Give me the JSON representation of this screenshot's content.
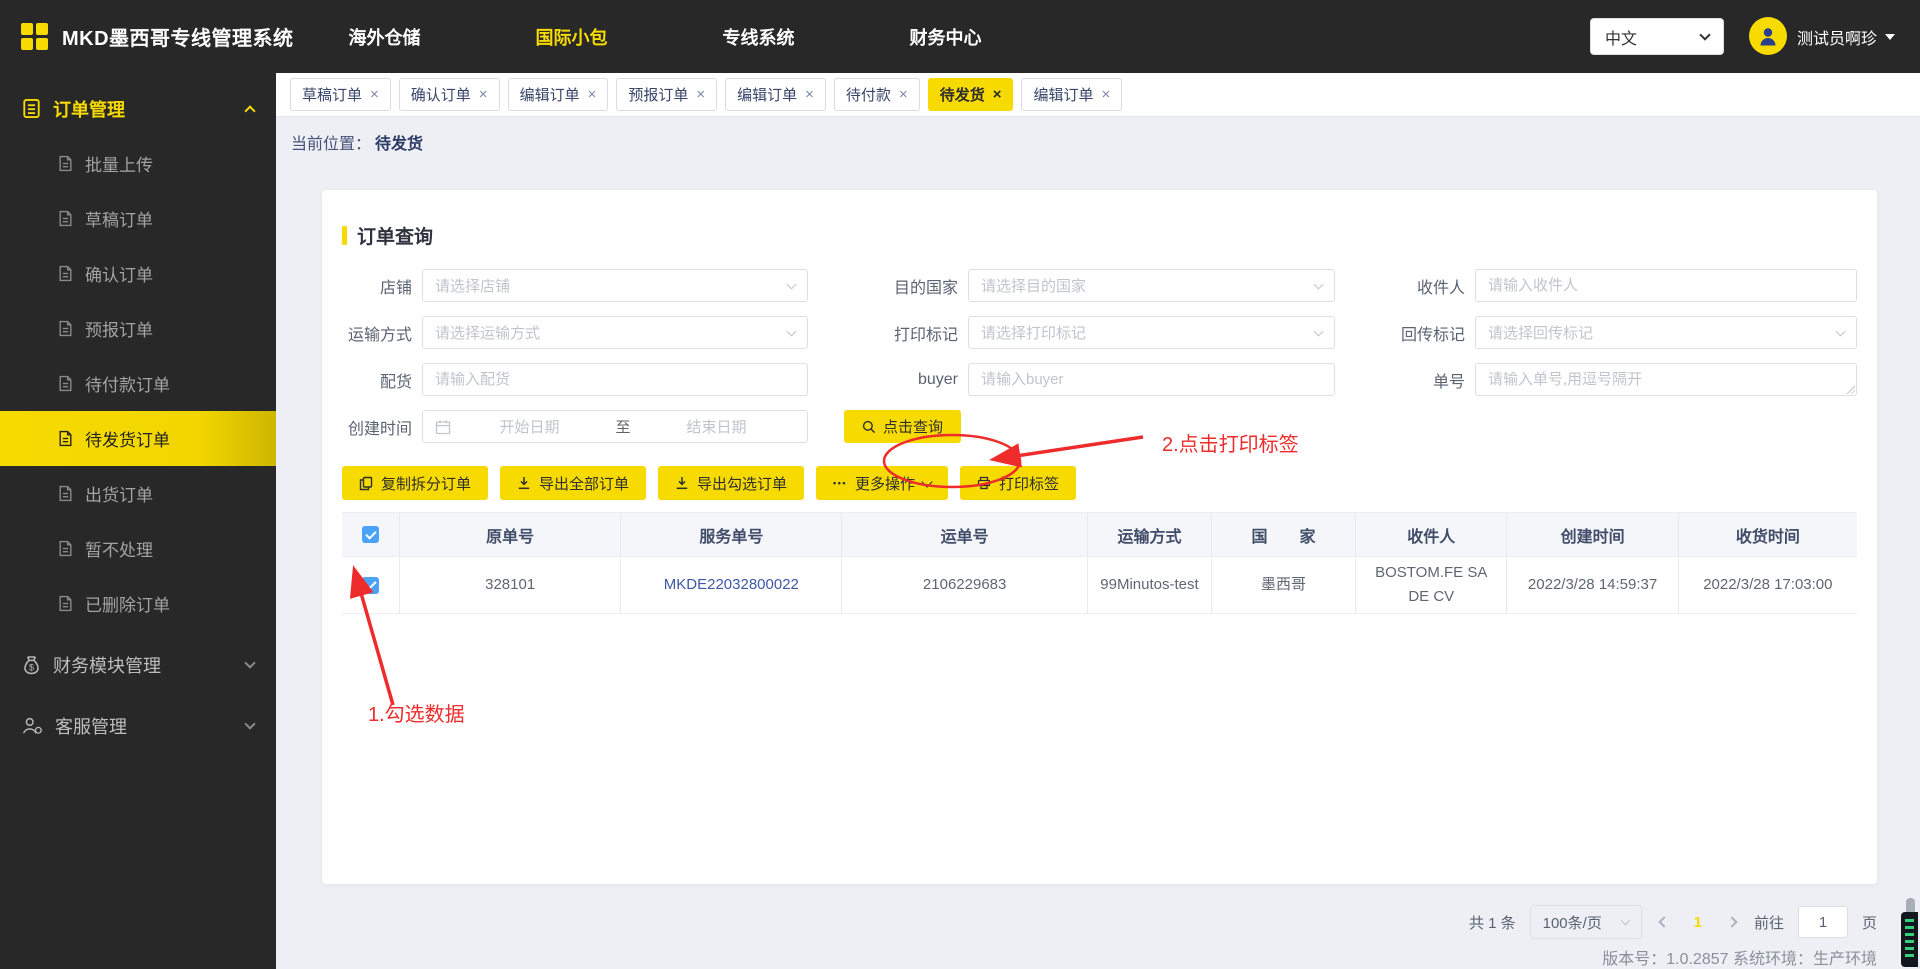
{
  "header": {
    "title": "MKD墨西哥专线管理系统",
    "nav": [
      {
        "label": "海外仓储",
        "active": false
      },
      {
        "label": "国际小包",
        "active": true
      },
      {
        "label": "专线系统",
        "active": false
      },
      {
        "label": "财务中心",
        "active": false
      }
    ],
    "language": "中文",
    "username": "测试员啊珍"
  },
  "sidebar": {
    "groups": [
      {
        "label": "订单管理",
        "expanded": true
      },
      {
        "label": "财务模块管理",
        "expanded": false
      },
      {
        "label": "客服管理",
        "expanded": false
      }
    ],
    "order_items": [
      "批量上传",
      "草稿订单",
      "确认订单",
      "预报订单",
      "待付款订单",
      "待发货订单",
      "出货订单",
      "暂不处理",
      "已删除订单"
    ],
    "active_item": "待发货订单"
  },
  "tabs": [
    {
      "label": "草稿订单",
      "active": false
    },
    {
      "label": "确认订单",
      "active": false
    },
    {
      "label": "编辑订单",
      "active": false
    },
    {
      "label": "预报订单",
      "active": false
    },
    {
      "label": "编辑订单",
      "active": false
    },
    {
      "label": "待付款",
      "active": false
    },
    {
      "label": "待发货",
      "active": true
    },
    {
      "label": "编辑订单",
      "active": false
    }
  ],
  "icons": {
    "close": "×",
    "more_dots": "•••"
  },
  "breadcrumb": {
    "prefix": "当前位置：",
    "current": "待发货"
  },
  "search": {
    "title": "订单查询",
    "shop": {
      "label": "店铺",
      "placeholder": "请选择店铺"
    },
    "country": {
      "label": "目的国家",
      "placeholder": "请选择目的国家"
    },
    "receiver": {
      "label": "收件人",
      "placeholder": "请输入收件人"
    },
    "transport": {
      "label": "运输方式",
      "placeholder": "请选择运输方式"
    },
    "print_mark": {
      "label": "打印标记",
      "placeholder": "请选择打印标记"
    },
    "return_mark": {
      "label": "回传标记",
      "placeholder": "请选择回传标记"
    },
    "allocation": {
      "label": "配货",
      "placeholder": "请输入配货"
    },
    "buyer": {
      "label": "buyer",
      "placeholder": "请输入buyer"
    },
    "order_no": {
      "label": "单号",
      "placeholder": "请输入单号,用逗号隔开"
    },
    "created": {
      "label": "创建时间",
      "start_placeholder": "开始日期",
      "to": "至",
      "end_placeholder": "结束日期"
    },
    "query_button": "点击查询"
  },
  "toolbar": {
    "buttons": [
      {
        "label": "复制拆分订单"
      },
      {
        "label": "导出全部订单"
      },
      {
        "label": "导出勾选订单"
      },
      {
        "label": "更多操作"
      },
      {
        "label": "打印标签"
      }
    ]
  },
  "table": {
    "headers": [
      "原单号",
      "服务单号",
      "运单号",
      "运输方式",
      "国　　家",
      "收件人",
      "创建时间",
      "收货时间"
    ],
    "rows": [
      {
        "checked": true,
        "origin_no": "328101",
        "service_no": "MKDE22032800022",
        "waybill_no": "2106229683",
        "transport": "99Minutos-test",
        "country": "墨西哥",
        "receiver": "BOSTOM.FE SA DE CV",
        "created_at": "2022/3/28 14:59:37",
        "received_at": "2022/3/28 17:03:00"
      }
    ]
  },
  "annotations": {
    "step1": "1.勾选数据",
    "step2": "2.点击打印标签"
  },
  "pagination": {
    "total": "共 1 条",
    "page_size": "100条/页",
    "current_page": "1",
    "goto_label": "前往",
    "goto_value": "1",
    "page_unit": "页"
  },
  "footer": {
    "version_label": "版本号：",
    "version": "1.0.2857",
    "env_label": "系统环境：",
    "env": "生产环境"
  },
  "colors": {
    "accent_yellow": "#f6da00",
    "dark_bg": "#282828",
    "link_blue": "#3f57a7",
    "checkbox_blue": "#4ba3f7",
    "annotation_red": "#ee2c2c"
  }
}
